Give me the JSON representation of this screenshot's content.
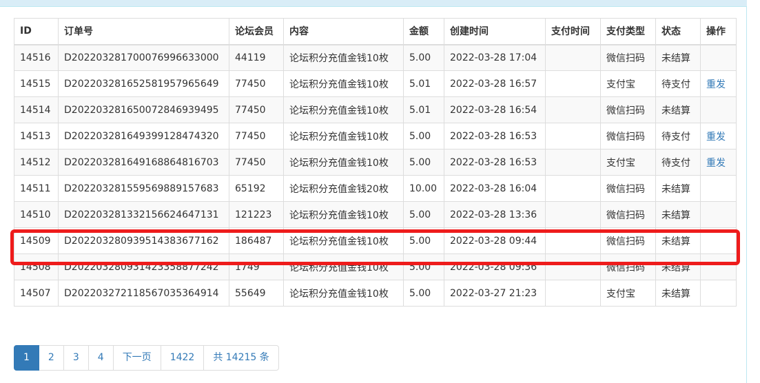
{
  "table": {
    "headers": [
      "ID",
      "订单号",
      "论坛会员",
      "内容",
      "金额",
      "创建时间",
      "支付时间",
      "支付类型",
      "状态",
      "操作"
    ],
    "rows": [
      {
        "id": "14516",
        "order_no": "D20220328170007699663300 0",
        "member": "44119",
        "content": "论坛积分充值金钱10枚",
        "amount": "5.00",
        "created": "2022-03-28 17:04",
        "paid": "",
        "pay_type": "微信扫码",
        "status": "未结算",
        "action": ""
      },
      {
        "id": "14515",
        "order_no": "D2022032816525819579656 49",
        "member": "77450",
        "content": "论坛积分充值金钱10枚",
        "amount": "5.01",
        "created": "2022-03-28 16:57",
        "paid": "",
        "pay_type": "支付宝",
        "status": "待支付",
        "action": "重发"
      },
      {
        "id": "14514",
        "order_no": "D2022032816500728469394 95",
        "member": "77450",
        "content": "论坛积分充值金钱10枚",
        "amount": "5.01",
        "created": "2022-03-28 16:54",
        "paid": "",
        "pay_type": "微信扫码",
        "status": "未结算",
        "action": ""
      },
      {
        "id": "14513",
        "order_no": "D2022032816493991284743 20",
        "member": "77450",
        "content": "论坛积分充值金钱10枚",
        "amount": "5.00",
        "created": "2022-03-28 16:53",
        "paid": "",
        "pay_type": "微信扫码",
        "status": "待支付",
        "action": "重发"
      },
      {
        "id": "14512",
        "order_no": "D2022032816491688648167 03",
        "member": "77450",
        "content": "论坛积分充值金钱10枚",
        "amount": "5.00",
        "created": "2022-03-28 16:53",
        "paid": "",
        "pay_type": "支付宝",
        "status": "待支付",
        "action": "重发"
      },
      {
        "id": "14511",
        "order_no": "D2022032815595698891576 83",
        "member": "65192",
        "content": "论坛积分充值金钱20枚",
        "amount": "10.00",
        "created": "2022-03-28 16:04",
        "paid": "",
        "pay_type": "微信扫码",
        "status": "未结算",
        "action": ""
      },
      {
        "id": "14510",
        "order_no": "D2022032813321566246471 31",
        "member": "121223",
        "content": "论坛积分充值金钱10枚",
        "amount": "5.00",
        "created": "2022-03-28 13:36",
        "paid": "",
        "pay_type": "微信扫码",
        "status": "未结算",
        "action": ""
      },
      {
        "id": "14509",
        "order_no": "D2022032809395143836771 62",
        "member": "186487",
        "content": "论坛积分充值金钱10枚",
        "amount": "5.00",
        "created": "2022-03-28 09:44",
        "paid": "",
        "pay_type": "微信扫码",
        "status": "未结算",
        "action": ""
      },
      {
        "id": "14508",
        "order_no": "D2022032809314233588772 42",
        "member": "1749",
        "content": "论坛积分充值金钱10枚",
        "amount": "5.00",
        "created": "2022-03-28 09:36",
        "paid": "",
        "pay_type": "微信扫码",
        "status": "未结算",
        "action": ""
      },
      {
        "id": "14507",
        "order_no": "D2022032721185670353649 14",
        "member": "55649",
        "content": "论坛积分充值金钱10枚",
        "amount": "5.00",
        "created": "2022-03-27 21:23",
        "paid": "",
        "pay_type": "支付宝",
        "status": "未结算",
        "action": ""
      }
    ]
  },
  "pagination": {
    "pages": [
      "1",
      "2",
      "3",
      "4"
    ],
    "next_label": "下一页",
    "last_page": "1422",
    "total_label": "共 14215 条"
  },
  "colors": {
    "highlight": "#ee1c1c",
    "link": "#337ab7",
    "active_page": "#337ab7"
  }
}
